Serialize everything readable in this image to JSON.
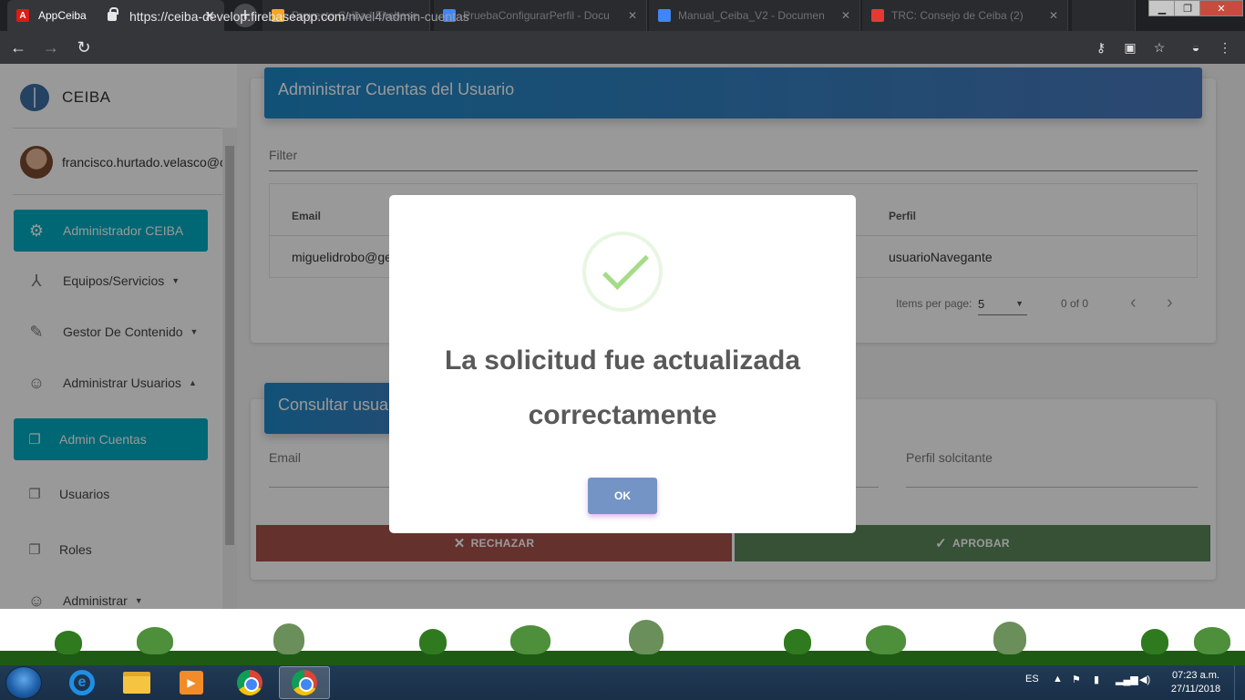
{
  "browser": {
    "active_tab": {
      "title": "AppCeiba",
      "icon": "angular-icon"
    },
    "background_tabs": [
      {
        "title": "Proyecto Ceiba | Firebase Co",
        "color": "#f5a623"
      },
      {
        "title": "PruebaConfigurarPerfil - Docu",
        "color": "#4285f4"
      },
      {
        "title": "Manual_Ceiba_V2 - Documen",
        "color": "#4285f4"
      },
      {
        "title": "TRC: Consejo de Ceiba (2)",
        "color": "#e53935"
      }
    ],
    "url_host": "https://ceiba-develop.firebaseapp.com",
    "url_path": "/nivel4/admin-cuentas",
    "window_controls": [
      "minimize",
      "maximize",
      "close"
    ]
  },
  "sidebar": {
    "brand": "CEIBA",
    "user_email": "francisco.hurtado.velasco@correo",
    "items": [
      {
        "label": "Administrador CEIBA",
        "icon": "gear-icon",
        "active": true
      },
      {
        "label": "Equipos/Servicios",
        "icon": "network-icon",
        "caret": "▼"
      },
      {
        "label": "Gestor De Contenido",
        "icon": "pencil-icon",
        "caret": "▼"
      },
      {
        "label": "Administrar Usuarios",
        "icon": "user-check-icon",
        "caret": "▲"
      },
      {
        "label": "Admin Cuentas",
        "icon": "copy-icon",
        "active": true
      },
      {
        "label": "Usuarios",
        "icon": "copy-icon"
      },
      {
        "label": "Roles",
        "icon": "copy-icon"
      },
      {
        "label": "Administrar",
        "icon": "user-check-icon",
        "caret": "▼"
      }
    ]
  },
  "accounts_panel": {
    "title": "Administrar Cuentas del Usuario",
    "filter_placeholder": "Filter",
    "columns": [
      "Email",
      "Perfil"
    ],
    "rows": [
      {
        "email": "miguelidrobo@ge",
        "perfil": "usuarioNavegante"
      }
    ],
    "items_per_page_label": "Items per page:",
    "items_per_page": "5",
    "range": "0 of 0"
  },
  "query_panel": {
    "title": "Consultar usuar",
    "email_label": "Email",
    "perfil_label": "Perfil solcitante",
    "reject_label": "RECHAZAR",
    "approve_label": "APROBAR",
    "reject_color": "#a8524b",
    "approve_color": "#5a875a"
  },
  "dialog": {
    "message": "La solicitud fue actualizada correctamente",
    "ok_label": "OK"
  },
  "taskbar": {
    "language": "ES",
    "time": "07:23 a.m.",
    "date": "27/11/2018"
  }
}
